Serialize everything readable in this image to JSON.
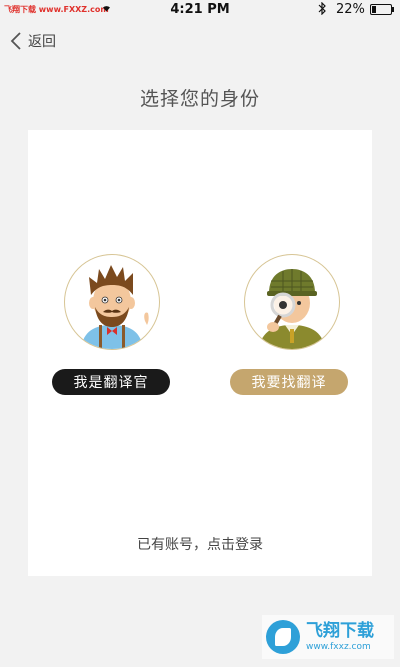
{
  "status_bar": {
    "carrier": "飞翔下载 www.FXXZ.com",
    "time": "4:21 PM",
    "battery_percent": "22%",
    "battery_level": 0.22
  },
  "nav": {
    "back_label": "返回"
  },
  "page": {
    "title": "选择您的身份"
  },
  "roles": {
    "translator_label": "我是翻译官",
    "seeker_label": "我要找翻译"
  },
  "login_prompt": "已有账号，点击登录",
  "watermark": {
    "title": "飞翔下载",
    "url": "www.fxxz.com"
  },
  "colors": {
    "accent_gold": "#c5a66e",
    "dark_button": "#1a1a1a",
    "background": "#f2f2f2"
  }
}
